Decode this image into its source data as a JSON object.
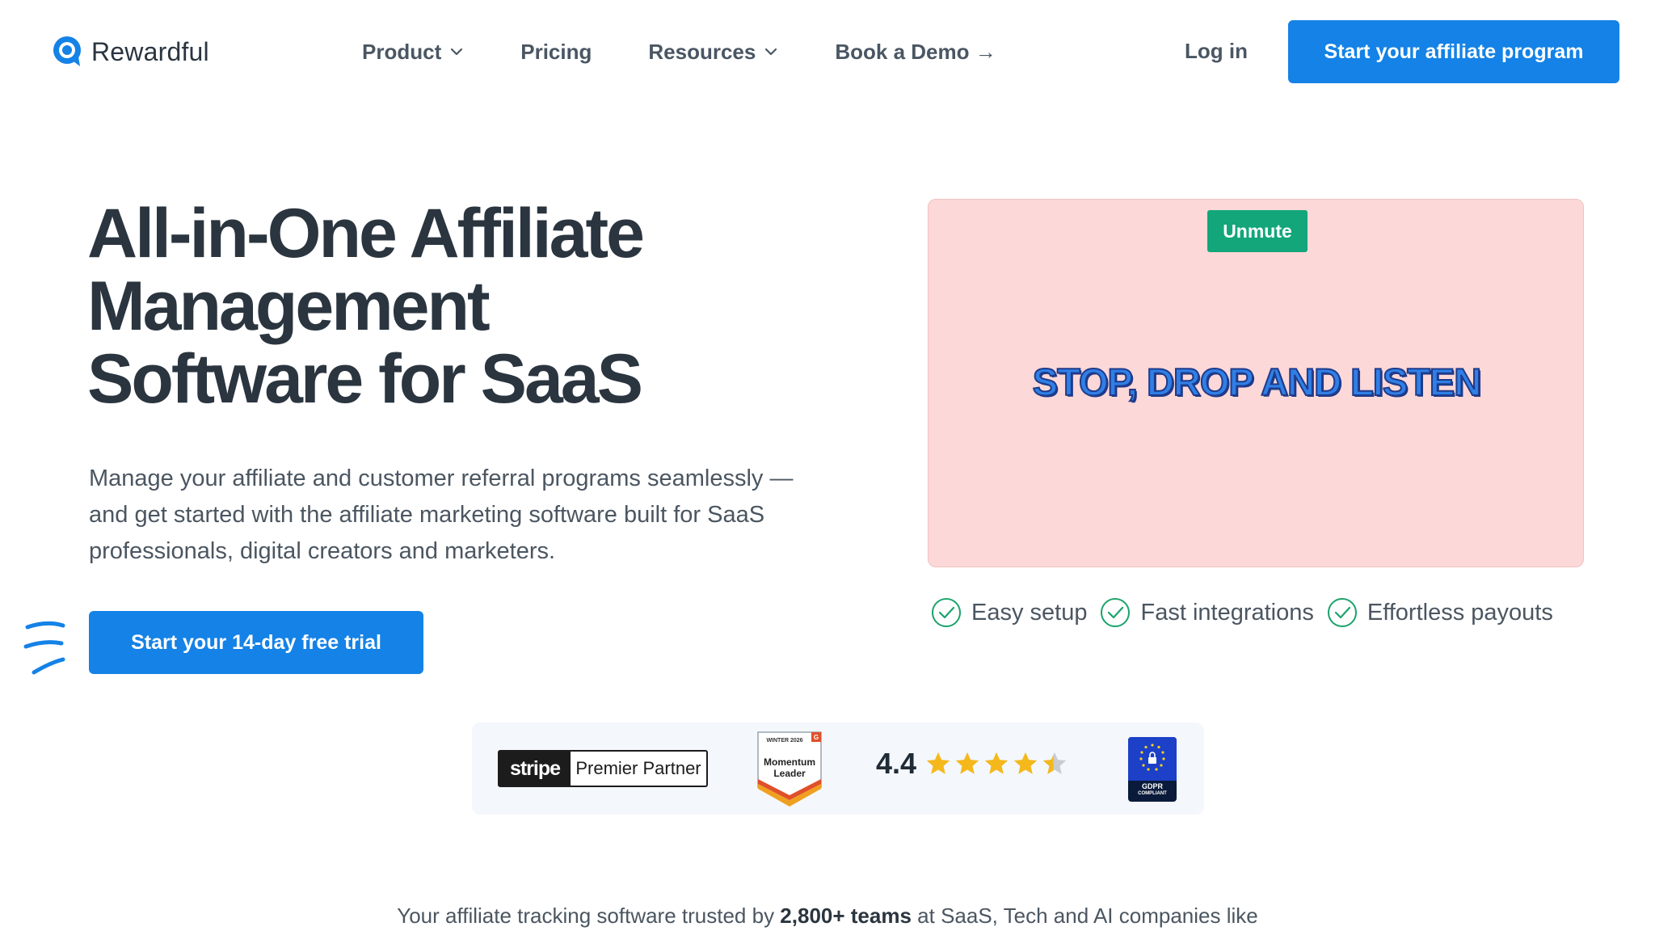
{
  "brand": {
    "name": "Rewardful",
    "accent": "#1482e6",
    "green": "#12a67a"
  },
  "nav": {
    "items": [
      {
        "label": "Product",
        "has_dropdown": true
      },
      {
        "label": "Pricing",
        "has_dropdown": false
      },
      {
        "label": "Resources",
        "has_dropdown": true
      },
      {
        "label": "Book a Demo →",
        "has_dropdown": false
      }
    ],
    "login": "Log in",
    "cta": "Start your affiliate program"
  },
  "hero": {
    "title_lines": [
      "All-in-One Affiliate",
      "Management",
      "Software for SaaS"
    ],
    "subtitle": "Manage your affiliate and customer referral programs seamlessly — and get started with the affiliate marketing software built for SaaS professionals, digital creators and marketers.",
    "cta": "Start your 14-day free trial"
  },
  "video": {
    "unmute": "Unmute",
    "caption": "STOP, DROP AND LISTEN"
  },
  "features": [
    "Easy setup",
    "Fast integrations",
    "Effortless payouts"
  ],
  "badges": {
    "stripe_logo": "stripe",
    "stripe_label": "Premier Partner",
    "g2_season": "WINTER 2026",
    "g2_title_1": "Momentum",
    "g2_title_2": "Leader",
    "rating": "4.4",
    "rating_value": 4.4,
    "gdpr_1": "GDPR",
    "gdpr_2": "COMPLIANT"
  },
  "trust": {
    "prefix": "Your affiliate tracking software trusted by ",
    "highlight": "2,800+ teams",
    "suffix": " at SaaS, Tech and AI companies like"
  }
}
